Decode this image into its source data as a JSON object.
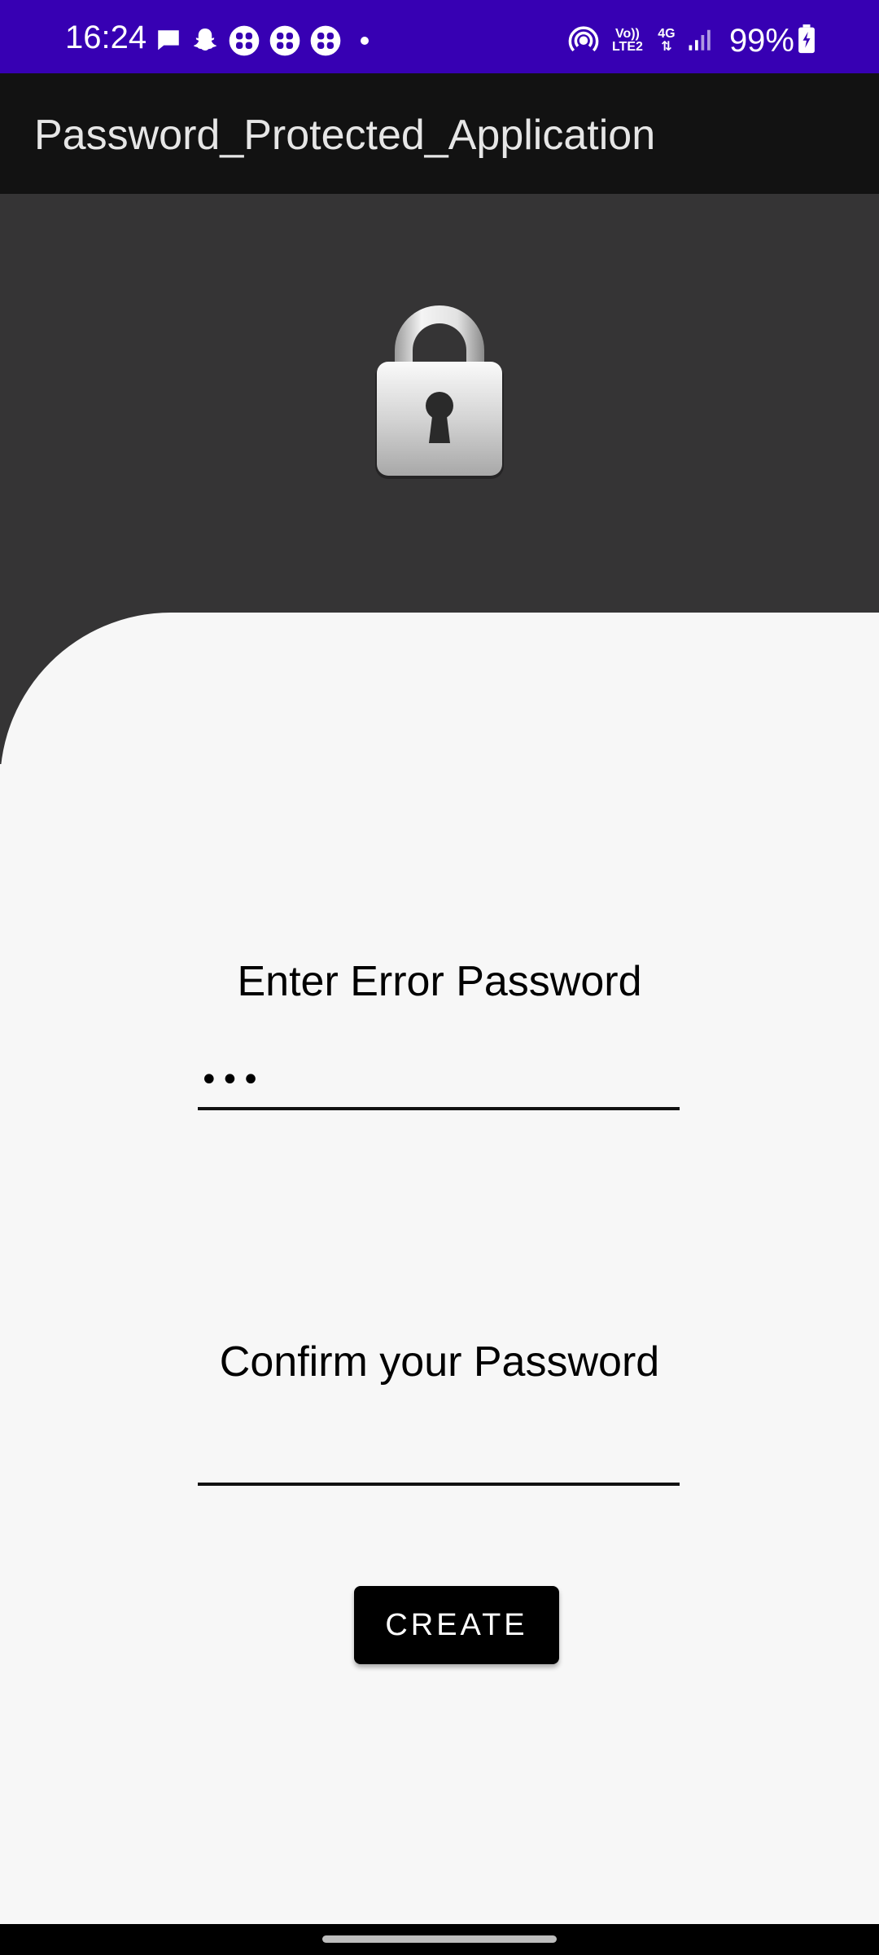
{
  "status_bar": {
    "time": "16:24",
    "battery": "99%",
    "network_label_volte": "Vo)) LTE2",
    "network_label_4g": "4G",
    "icons": [
      "message-icon",
      "snapchat-icon",
      "app-grid-icon",
      "app-grid-icon",
      "app-grid-icon",
      "dot-icon",
      "hotspot-icon",
      "signal-icon",
      "battery-charging-icon"
    ]
  },
  "app_bar": {
    "title": "Password_Protected_Application"
  },
  "header": {
    "icon": "lock-icon"
  },
  "form": {
    "password_label": "Enter Error Password",
    "password_value": "•••",
    "confirm_label": "Confirm your Password",
    "confirm_value": "",
    "create_button": "CREATE"
  },
  "colors": {
    "status_bar": "#3700b3",
    "app_bar": "#121212",
    "header_dark": "#353435",
    "sheet": "#f7f7f7",
    "button": "#000000"
  }
}
